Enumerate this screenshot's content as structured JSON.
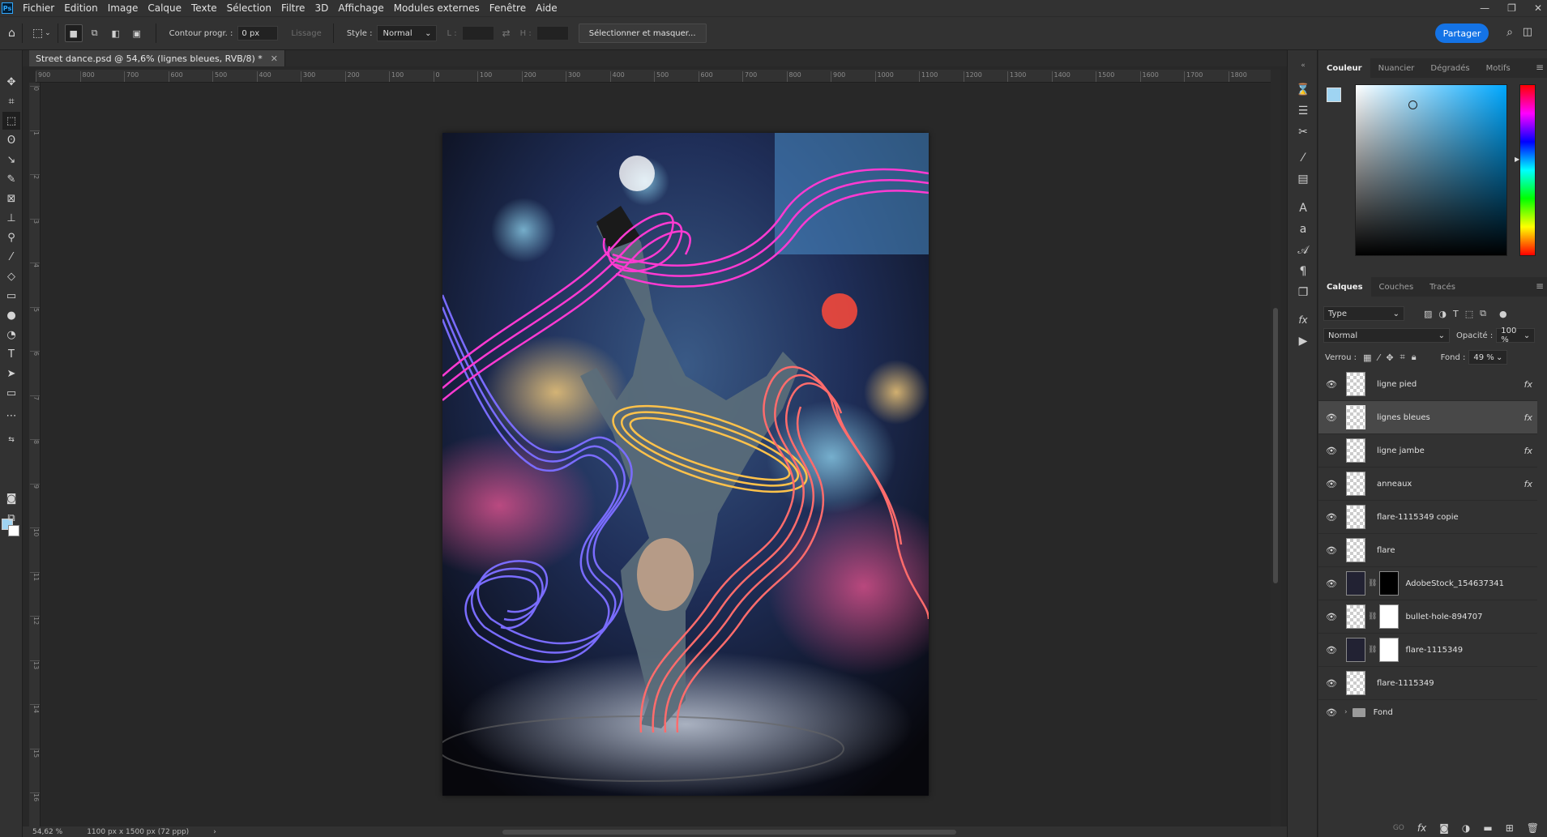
{
  "menu": [
    "Fichier",
    "Edition",
    "Image",
    "Calque",
    "Texte",
    "Sélection",
    "Filtre",
    "3D",
    "Affichage",
    "Modules externes",
    "Fenêtre",
    "Aide"
  ],
  "options": {
    "feather_label": "Contour progr. :",
    "feather_value": "0 px",
    "antialias_label": "Lissage",
    "style_label": "Style :",
    "style_value": "Normal",
    "width_label": "L :",
    "height_label": "H :",
    "select_mask_button": "Sélectionner et masquer...",
    "share_button": "Partager"
  },
  "document": {
    "tab_title": "Street dance.psd @ 54,6% (lignes bleues, RVB/8) *",
    "zoom": "54,62 %",
    "dimensions": "1100 px x 1500 px (72 ppp)"
  },
  "ruler_h": [
    "900",
    "800",
    "700",
    "600",
    "500",
    "400",
    "300",
    "200",
    "100",
    "0",
    "100",
    "200",
    "300",
    "400",
    "500",
    "600",
    "700",
    "800",
    "900",
    "1000",
    "1100",
    "1200",
    "1300",
    "1400",
    "1500",
    "1600",
    "1700",
    "1800"
  ],
  "ruler_v": [
    "0",
    "1",
    "2",
    "3",
    "4",
    "5",
    "6",
    "7",
    "8",
    "9",
    "10",
    "11",
    "12",
    "13",
    "14",
    "15",
    "16"
  ],
  "color_panel": {
    "tabs": [
      "Couleur",
      "Nuancier",
      "Dégradés",
      "Motifs"
    ],
    "fg_color": "#9fd4f2",
    "bg_color": "#ffffff"
  },
  "layers_panel": {
    "tabs": [
      "Calques",
      "Couches",
      "Tracés"
    ],
    "filter_value": "Type",
    "blend_mode": "Normal",
    "opacity_label": "Opacité :",
    "opacity_value": "100 %",
    "lock_label": "Verrou :",
    "fill_label": "Fond :",
    "fill_value": "49 %",
    "layers": [
      {
        "name": "ligne pied",
        "fx": "fx",
        "selected": false
      },
      {
        "name": "lignes bleues",
        "fx": "fx",
        "selected": true
      },
      {
        "name": "ligne jambe",
        "fx": "fx",
        "selected": false
      },
      {
        "name": "anneaux",
        "fx": "fx",
        "selected": false
      },
      {
        "name": "flare-1115349 copie",
        "fx": "",
        "selected": false
      },
      {
        "name": "flare",
        "fx": "",
        "selected": false
      },
      {
        "name": "AdobeStock_154637341",
        "fx": "",
        "selected": false
      },
      {
        "name": "bullet-hole-894707",
        "fx": "",
        "selected": false
      },
      {
        "name": "flare-1115349",
        "fx": "",
        "selected": false
      },
      {
        "name": "flare-1115349",
        "fx": "",
        "selected": false
      }
    ],
    "group_name": "Fond",
    "bottom_link": "GO"
  }
}
